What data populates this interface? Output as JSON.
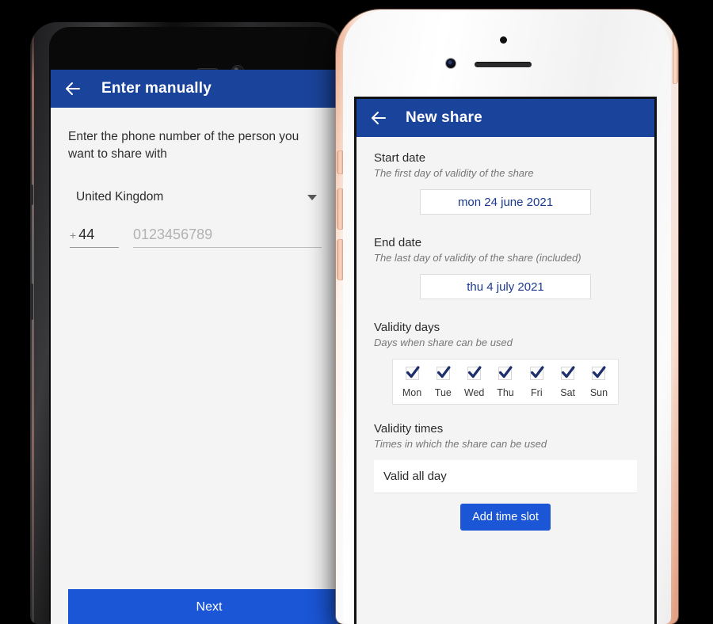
{
  "colors": {
    "header_blue": "#1a449b",
    "action_blue": "#1a56d6",
    "date_text_navy": "#1b3a8f",
    "screen_bg": "#f4f4f4",
    "hint_gray": "#77777a"
  },
  "left_phone": {
    "device": "android-dark-phone",
    "hardware": {
      "speaker_grille": "speaker-grille",
      "front_camera": "front-camera"
    },
    "header": {
      "back_icon": "back-arrow-icon",
      "title": "Enter manually"
    },
    "instruction": "Enter the phone number of the person you want to share with",
    "country_select": {
      "value": "United Kingdom",
      "caret_icon": "chevron-down-icon"
    },
    "phone_input": {
      "country_code_prefix": "+",
      "country_code": "44",
      "placeholder": "0123456789",
      "value": ""
    },
    "primary_button": "Next"
  },
  "right_phone": {
    "device": "iphone-white-rose-gold",
    "hardware": {
      "proximity_sensor": "proximity-sensor",
      "front_camera": "front-camera",
      "earpiece_speaker": "earpiece-speaker"
    },
    "header": {
      "back_icon": "back-arrow-icon",
      "title": "New share"
    },
    "sections": {
      "start_date": {
        "label": "Start date",
        "hint": "The first day of validity of the share",
        "value": "mon 24 june 2021"
      },
      "end_date": {
        "label": "End date",
        "hint": "The last day of validity of the share (included)",
        "value": "thu 4 july 2021"
      },
      "validity_days": {
        "label": "Validity days",
        "hint": "Days when share can be used",
        "days": [
          {
            "name": "Mon",
            "checked": true
          },
          {
            "name": "Tue",
            "checked": true
          },
          {
            "name": "Wed",
            "checked": true
          },
          {
            "name": "Thu",
            "checked": true
          },
          {
            "name": "Fri",
            "checked": true
          },
          {
            "name": "Sat",
            "checked": true
          },
          {
            "name": "Sun",
            "checked": true
          }
        ]
      },
      "validity_times": {
        "label": "Validity times",
        "hint": "Times in which the share can be used",
        "current_slot": "Valid all day",
        "add_button": "Add time slot"
      }
    }
  }
}
